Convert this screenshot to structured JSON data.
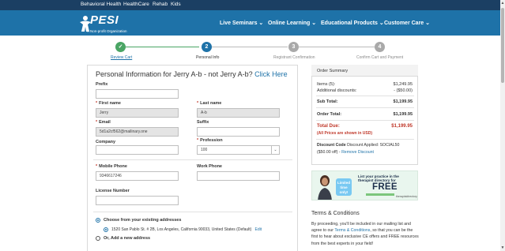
{
  "topbar": {
    "links": [
      "Behavioral Health",
      "HealthCare",
      "Rehab",
      "Kids"
    ]
  },
  "header": {
    "logo": "PESI",
    "logo_sub": "A Non-profit Organization",
    "nav": [
      "Live Seminars",
      "Online Learning",
      "Educational Products",
      "Customer Care"
    ]
  },
  "steps": [
    {
      "number": "✓",
      "label": "Review Cart",
      "state": "done"
    },
    {
      "number": "2",
      "label": "Personal Info",
      "state": "active"
    },
    {
      "number": "3",
      "label": "Registrant Confirmation",
      "state": "pending"
    },
    {
      "number": "4",
      "label": "Confirm Cart and Payment",
      "state": "pending"
    }
  ],
  "form": {
    "title": "Personal Information for Jerry A-b - not Jerry A-b?",
    "title_link": "Click Here",
    "prefix_label": "Prefix",
    "prefix_value": "",
    "first_name_label": "First name",
    "first_name_value": "Jerry",
    "last_name_label": "Last name",
    "last_name_value": "A-b",
    "email_label": "Email",
    "email_value": "5d1a2cf562@mailinary.one",
    "suffix_label": "Suffix",
    "suffix_value": "",
    "company_label": "Company",
    "company_value": "",
    "profession_label": "Profession",
    "profession_value": "100",
    "mobile_label": "Mobile Phone",
    "mobile_value": "9346617246",
    "work_label": "Work Phone",
    "work_value": "",
    "license_label": "License Number",
    "license_value": "",
    "address_choose_label": "Choose from your existing addresses",
    "address_line": "1520 San Pablo St. # 2B, Los Angeles, California 90033, United States (Default)",
    "address_edit": "Edit",
    "address_new_label": "Or, Add a new address"
  },
  "order": {
    "title": "Order Summary",
    "items_label": "Items (5):",
    "items_value": "$1,249.95",
    "discounts_label": "Additional discounts:",
    "discounts_value": "- ($50.00)",
    "subtotal_label": "Sub Total:",
    "subtotal_value": "$1,199.95",
    "ordertotal_label": "Order Total:",
    "ordertotal_value": "$1,199.95",
    "totaldue_label": "Total Due:",
    "totaldue_value": "$1,199.95",
    "usd_note": "(All Prices are shown in USD)",
    "discount_code_label": "Discount Code",
    "discount_code_text": "Discount Applied: SOCIAL50",
    "discount_amount": "($50.00 off) -",
    "remove_link": "Remove Discount"
  },
  "ad": {
    "badge": "Limited time only!",
    "line1": "List your practice in the",
    "line2": "therapist directory for",
    "free": "FREE",
    "brand": "therapistdirectory"
  },
  "terms": {
    "title": "Terms & Conditions",
    "text_before": "By proceeding, you'll be included in our mailing list and agree to our",
    "link": "Terms & Conditions",
    "text_after": ", so that you can be the first to hear about exclusive CE offers and FREE resources from the best experts in your field!"
  },
  "colors": {
    "topbar": "#1b3f63",
    "header": "#1e72a8",
    "step_done": "#4aa564",
    "step_active": "#1e72a8",
    "step_pending": "#a9a9a9",
    "red": "#c0392b"
  }
}
